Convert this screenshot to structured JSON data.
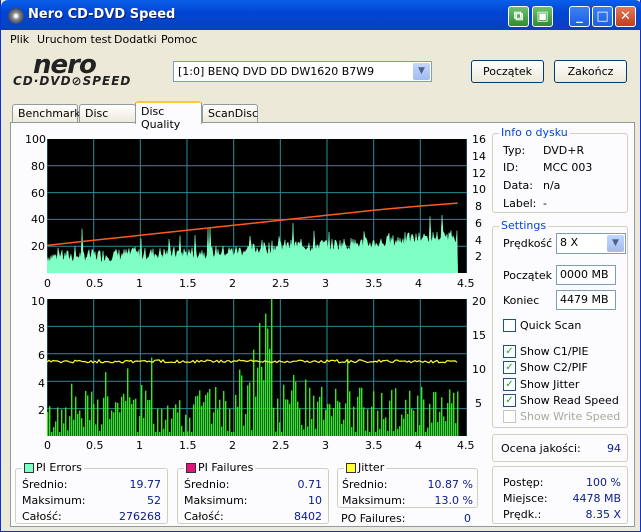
{
  "window": {
    "title": "Nero CD-DVD Speed"
  },
  "menu": [
    "Plik",
    "Uruchom test",
    "Dodatki",
    "Pomoc"
  ],
  "logo": {
    "brand": "nero",
    "product": "CD·DVD⊘SPEED"
  },
  "drive": {
    "selected": "[1:0]  BENQ DVD DD DW1620 B7W9"
  },
  "buttons": {
    "start": "Początek",
    "end": "Zakończ"
  },
  "tabs": [
    "Benchmark",
    "Disc Info",
    "Disc Quality",
    "ScanDisc"
  ],
  "disc_info": {
    "title": "Info o dysku",
    "rows": [
      {
        "label": "Typ:",
        "value": "DVD+R"
      },
      {
        "label": "ID:",
        "value": "MCC 003"
      },
      {
        "label": "Data:",
        "value": "n/a"
      },
      {
        "label": "Label:",
        "value": "-"
      }
    ]
  },
  "settings": {
    "title": "Settings",
    "speed_label": "Prędkość",
    "speed_value": "8 X",
    "start_label": "Początek",
    "start_value": "0000 MB",
    "end_label": "Koniec",
    "end_value": "4479 MB",
    "quick_scan": "Quick Scan",
    "options": [
      {
        "label": "Show C1/PIE",
        "checked": true,
        "enabled": true
      },
      {
        "label": "Show C2/PIF",
        "checked": true,
        "enabled": true
      },
      {
        "label": "Show Jitter",
        "checked": true,
        "enabled": true
      },
      {
        "label": "Show Read Speed",
        "checked": true,
        "enabled": true
      },
      {
        "label": "Show Write Speed",
        "checked": false,
        "enabled": false
      }
    ]
  },
  "quality": {
    "label": "Ocena jakości:",
    "value": "94"
  },
  "progress": [
    {
      "label": "Postęp:",
      "value": "100 %"
    },
    {
      "label": "Miejsce:",
      "value": "4478 MB"
    },
    {
      "label": "Prędk.:",
      "value": "8.35 X"
    }
  ],
  "pi_errors": {
    "title": "PI Errors",
    "color": "#7fffc4",
    "rows": [
      {
        "label": "Średnio:",
        "value": "19.77"
      },
      {
        "label": "Maksimum:",
        "value": "52"
      },
      {
        "label": "Całość:",
        "value": "276268"
      }
    ]
  },
  "pi_failures": {
    "title": "PI Failures",
    "color": "#e0147a",
    "rows": [
      {
        "label": "Średnio:",
        "value": "0.71"
      },
      {
        "label": "Maksimum:",
        "value": "10"
      },
      {
        "label": "Całość:",
        "value": "8402"
      }
    ]
  },
  "jitter": {
    "title": "Jitter",
    "color": "#ffff33",
    "rows": [
      {
        "label": "Średnio:",
        "value": "10.87 %"
      },
      {
        "label": "Maksimum:",
        "value": "13.0 %"
      }
    ]
  },
  "po_failures": {
    "label": "PO Failures:",
    "value": "0"
  },
  "chart_data": [
    {
      "type": "area",
      "x_ticks": [
        "0",
        "0.5",
        "1",
        "1.5",
        "2",
        "2.5",
        "3",
        "3.5",
        "4",
        "4.5"
      ],
      "y_left_ticks": [
        "100",
        "80",
        "60",
        "40",
        "20"
      ],
      "y_right_ticks": [
        "16",
        "14",
        "12",
        "10",
        "8",
        "6",
        "4",
        "2"
      ],
      "ylim_left": [
        0,
        100
      ],
      "ylim_right": [
        0,
        16
      ],
      "xlim": [
        0,
        4.5
      ],
      "series": [
        {
          "name": "PI Errors",
          "color": "#7fffc4",
          "x": [
            0,
            0.5,
            1,
            1.5,
            2,
            2.5,
            3,
            3.5,
            4,
            4.4
          ],
          "values": [
            12,
            13,
            14,
            15,
            16,
            20,
            21,
            22,
            26,
            28
          ]
        },
        {
          "name": "Read Speed",
          "color": "#ff5a1e",
          "x": [
            0,
            0.5,
            1,
            1.5,
            2,
            2.5,
            3,
            3.5,
            4,
            4.4
          ],
          "values": [
            3.3,
            3.9,
            4.5,
            5.1,
            5.7,
            6.3,
            6.9,
            7.5,
            8.0,
            8.35
          ]
        }
      ]
    },
    {
      "type": "bar",
      "x_ticks": [
        "0",
        "0.5",
        "1",
        "1.5",
        "2",
        "2.5",
        "3",
        "3.5",
        "4",
        "4.5"
      ],
      "y_left_ticks": [
        "10",
        "8",
        "6",
        "4",
        "2"
      ],
      "y_right_ticks": [
        "20",
        "15",
        "10",
        "5"
      ],
      "ylim_left": [
        0,
        10
      ],
      "ylim_right": [
        0,
        20
      ],
      "xlim": [
        0,
        4.5
      ],
      "series": [
        {
          "name": "PI Failures",
          "color": "#33ee00",
          "x": [
            0,
            0.5,
            1,
            1.5,
            2,
            2.4,
            2.5,
            3,
            3.5,
            4,
            4.4
          ],
          "values": [
            2,
            3,
            3,
            3,
            3,
            9,
            4,
            3,
            3,
            3,
            3
          ]
        },
        {
          "name": "Jitter",
          "color": "#ffff33",
          "x": [
            0,
            4.4
          ],
          "values": [
            10.9,
            10.9
          ]
        }
      ]
    }
  ]
}
